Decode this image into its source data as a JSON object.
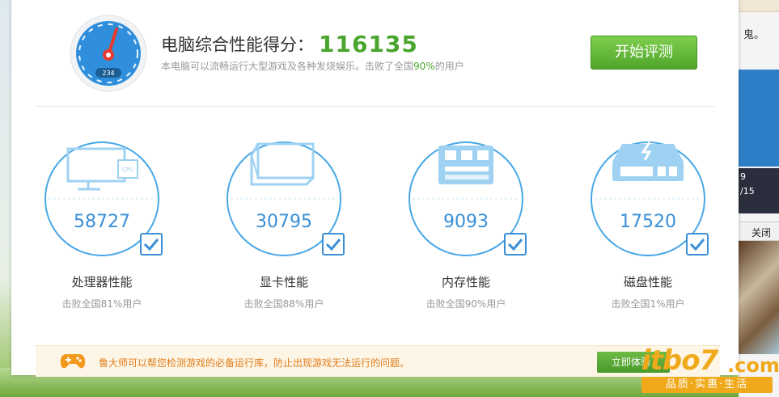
{
  "header": {
    "title_label": "电脑综合性能得分：",
    "score": "116135",
    "desc_prefix": "本电脑可以流畅运行大型游戏及各种发烧娱乐。击败了全国",
    "desc_pct": "90%",
    "desc_suffix": "的用户",
    "start_button": "开始评测",
    "gauge_readout": "234"
  },
  "cards": [
    {
      "value": "58727",
      "name": "处理器性能",
      "desc": "击败全国81%用户",
      "icon_text": "CPU"
    },
    {
      "value": "30795",
      "name": "显卡性能",
      "desc": "击败全国88%用户"
    },
    {
      "value": "9093",
      "name": "内存性能",
      "desc": "击败全国90%用户"
    },
    {
      "value": "17520",
      "name": "磁盘性能",
      "desc": "击败全国1%用户"
    }
  ],
  "tip": {
    "text": "鲁大师可以帮您检测游戏的必备运行库，防止出现游戏无法运行的问题。",
    "button": "立即体验"
  },
  "background": {
    "fragment_text": "鬼。",
    "thumb_date_1": "9",
    "thumb_date_2": "/15",
    "close_label": "关闭"
  },
  "watermark": {
    "brand": "itbo7",
    "brand_suffix": ".com",
    "slogan": "品质·实惠·生活"
  },
  "colors": {
    "accent_green": "#4aa52e",
    "accent_blue": "#3a8fd6",
    "tip_orange": "#e07b1a"
  }
}
